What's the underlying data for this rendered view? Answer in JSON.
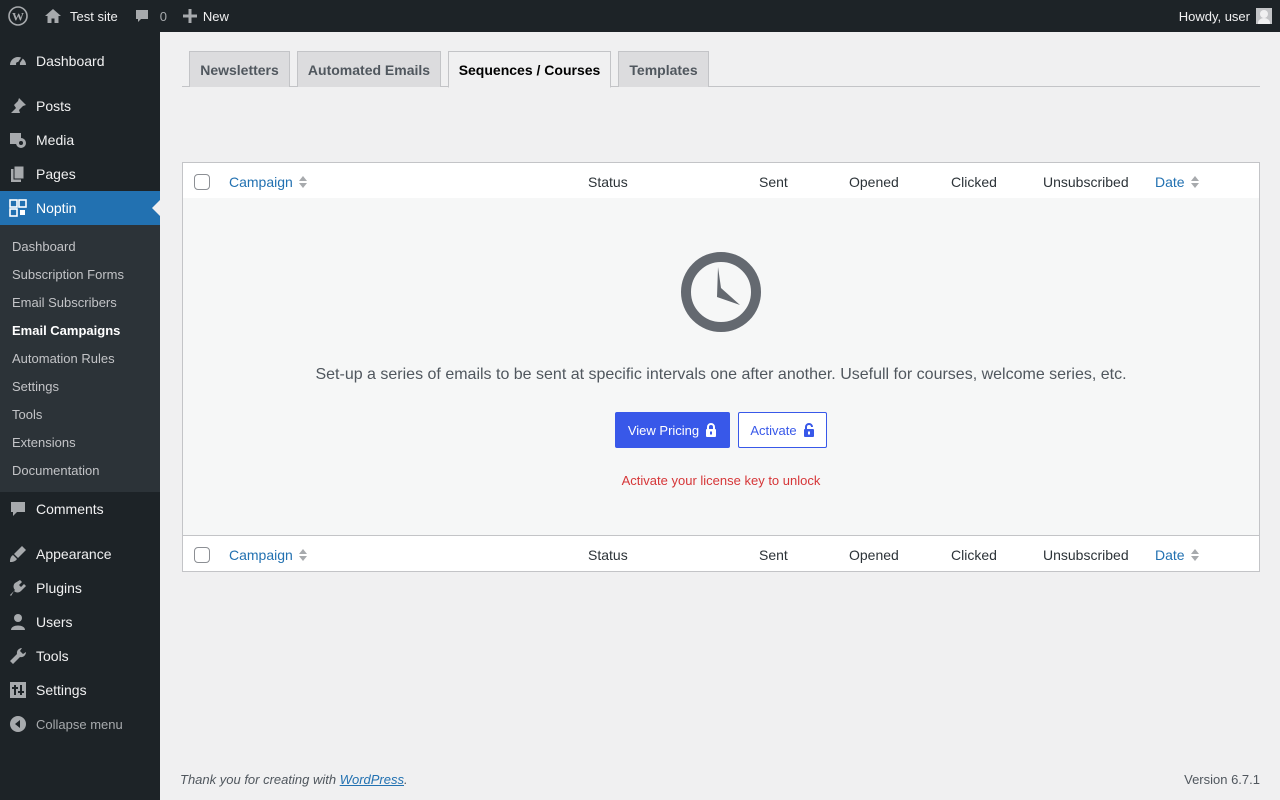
{
  "adminbar": {
    "site_name": "Test site",
    "comments_count": "0",
    "new_label": "New",
    "howdy": "Howdy, user"
  },
  "sidebar": {
    "items": [
      {
        "label": "Dashboard",
        "icon": "dashboard-icon"
      },
      {
        "label": "Posts",
        "icon": "pin-icon"
      },
      {
        "label": "Media",
        "icon": "media-icon"
      },
      {
        "label": "Pages",
        "icon": "pages-icon"
      },
      {
        "label": "Noptin",
        "icon": "noptin-icon"
      },
      {
        "label": "Comments",
        "icon": "comment-icon"
      },
      {
        "label": "Appearance",
        "icon": "brush-icon"
      },
      {
        "label": "Plugins",
        "icon": "plug-icon"
      },
      {
        "label": "Users",
        "icon": "user-icon"
      },
      {
        "label": "Tools",
        "icon": "wrench-icon"
      },
      {
        "label": "Settings",
        "icon": "settings-icon"
      }
    ],
    "submenu": [
      "Dashboard",
      "Subscription Forms",
      "Email Subscribers",
      "Email Campaigns",
      "Automation Rules",
      "Settings",
      "Tools",
      "Extensions",
      "Documentation"
    ],
    "submenu_current": "Email Campaigns",
    "collapse_label": "Collapse menu"
  },
  "tabs": [
    "Newsletters",
    "Automated Emails",
    "Sequences / Courses",
    "Templates"
  ],
  "active_tab": "Sequences / Courses",
  "table": {
    "columns": [
      "Campaign",
      "Status",
      "Sent",
      "Opened",
      "Clicked",
      "Unsubscribed",
      "Date"
    ],
    "sortable": [
      "Campaign",
      "Date"
    ]
  },
  "empty_state": {
    "message": "Set-up a series of emails to be sent at specific intervals one after another. Usefull for courses, welcome series, etc.",
    "view_pricing_label": "View Pricing",
    "activate_label": "Activate",
    "note": "Activate your license key to unlock"
  },
  "footer": {
    "thanks_prefix": "Thank you for creating with ",
    "thanks_link": "WordPress",
    "thanks_suffix": ".",
    "version": "Version 6.7.1"
  },
  "colors": {
    "admin_dark": "#1d2327",
    "accent": "#2271b1",
    "button_blue": "#3858e9",
    "notice_red": "#d63638"
  }
}
